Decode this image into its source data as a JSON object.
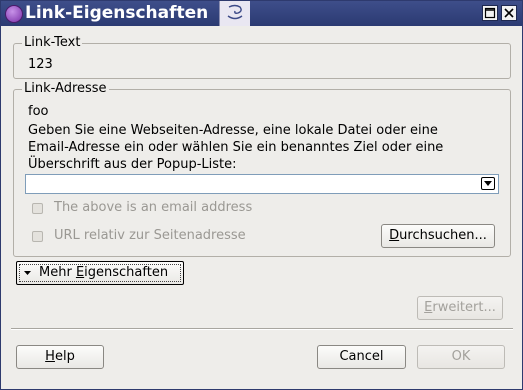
{
  "window": {
    "title": "Link-Eigenschaften"
  },
  "link_text": {
    "legend": "Link-Text",
    "value": "123"
  },
  "link_address": {
    "legend": "Link-Adresse",
    "value": "foo",
    "description_lines": [
      "Geben Sie eine Webseiten-Adresse, eine lokale Datei oder eine",
      "Email-Adresse ein oder wählen Sie ein benanntes Ziel oder eine",
      "Überschrift aus der Popup-Liste:"
    ],
    "combo_value": "",
    "email_checkbox_label": "The above is an email address",
    "relative_checkbox_label": "URL relativ zur Seitenadresse",
    "browse_button": {
      "u": "D",
      "rest": "urchsuchen..."
    }
  },
  "more_props": {
    "pre": "Mehr ",
    "u": "E",
    "rest": "igenschaften"
  },
  "advanced_button": {
    "u": "E",
    "rest": "rweitert..."
  },
  "help_button": {
    "u": "H",
    "rest": "elp"
  },
  "cancel_label": "Cancel",
  "ok_label": "OK"
}
